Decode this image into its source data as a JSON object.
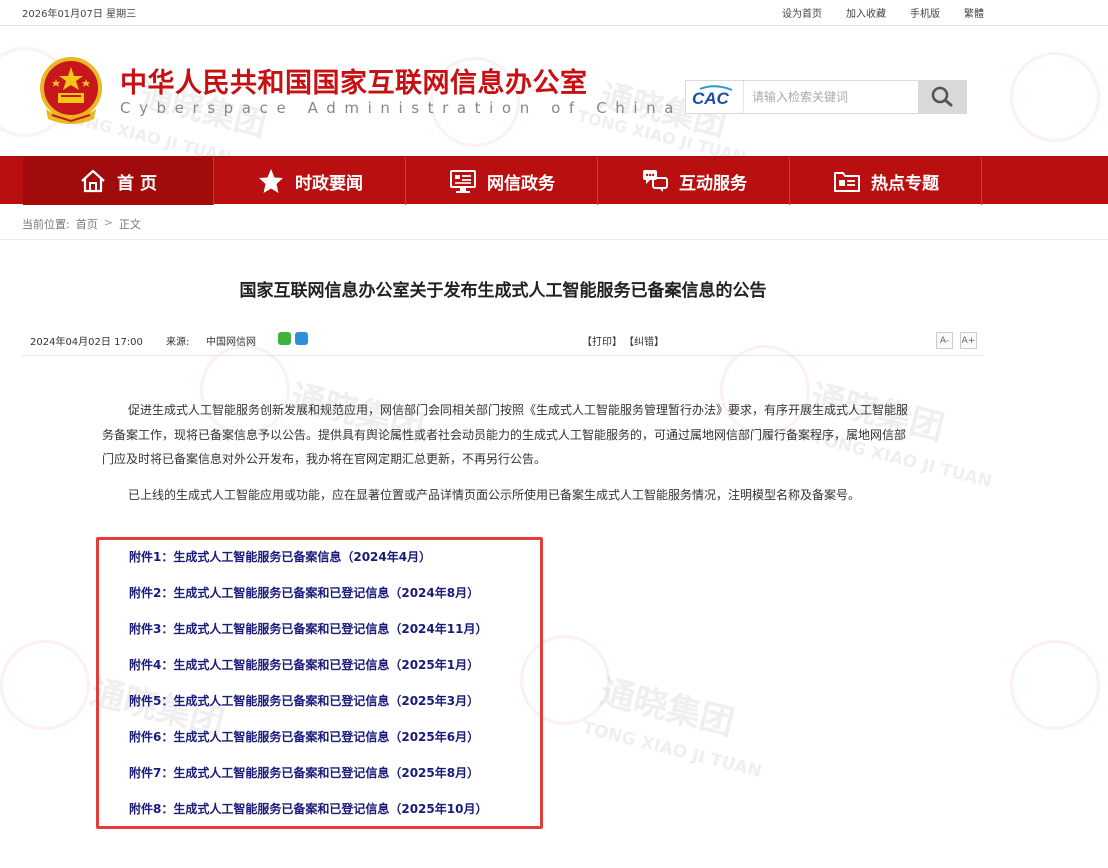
{
  "topbar": {
    "date": "2026年01月07日 星期三",
    "links": [
      "设为首页",
      "加入收藏",
      "手机版",
      "繁體"
    ]
  },
  "header": {
    "title": "中华人民共和国国家互联网信息办公室",
    "subtitle": "Cyberspace Administration of China",
    "search_logo": "CAC",
    "search_placeholder": "请输入检索关键词"
  },
  "watermark": {
    "brand": "通晓集团",
    "latin": "TONG XIAO JI TUAN"
  },
  "nav": [
    {
      "label": "首 页",
      "icon": "home-icon"
    },
    {
      "label": "时政要闻",
      "icon": "star-icon"
    },
    {
      "label": "网信政务",
      "icon": "monitor-icon"
    },
    {
      "label": "互动服务",
      "icon": "chat-icon"
    },
    {
      "label": "热点专题",
      "icon": "folder-icon"
    }
  ],
  "breadcrumb": {
    "label": "当前位置:",
    "items": [
      "首页",
      "正文"
    ],
    "separator": ">"
  },
  "article": {
    "title": "国家互联网信息办公室关于发布生成式人工智能服务已备案信息的公告",
    "date": "2024年04月02日 17:00",
    "source_label": "来源:",
    "source": "中国网信网",
    "print": "【打印】",
    "correct": "【纠错】",
    "font_smaller": "A-",
    "font_larger": "A+",
    "paragraphs": [
      "促进生成式人工智能服务创新发展和规范应用，网信部门会同相关部门按照《生成式人工智能服务管理暂行办法》要求，有序开展生成式人工智能服务备案工作，现将已备案信息予以公告。提供具有舆论属性或者社会动员能力的生成式人工智能服务的，可通过属地网信部门履行备案程序，属地网信部门应及时将已备案信息对外公开发布，我办将在官网定期汇总更新，不再另行公告。",
      "已上线的生成式人工智能应用或功能，应在显著位置或产品详情页面公示所使用已备案生成式人工智能服务情况，注明模型名称及备案号。"
    ],
    "attachments": [
      "附件1：生成式人工智能服务已备案信息（2024年4月）",
      "附件2：生成式人工智能服务已备案和已登记信息（2024年8月）",
      "附件3：生成式人工智能服务已备案和已登记信息（2024年11月）",
      "附件4：生成式人工智能服务已备案和已登记信息（2025年1月）",
      "附件5：生成式人工智能服务已备案和已登记信息（2025年3月）",
      "附件6：生成式人工智能服务已备案和已登记信息（2025年6月）",
      "附件7：生成式人工智能服务已备案和已登记信息（2025年8月）",
      "附件8：生成式人工智能服务已备案和已登记信息（2025年10月）"
    ]
  },
  "colors": {
    "nav_bg": "#b90f10",
    "title_red": "#c81013",
    "link_blue": "#1a1a7a",
    "highlight_border": "#e63c3c"
  }
}
